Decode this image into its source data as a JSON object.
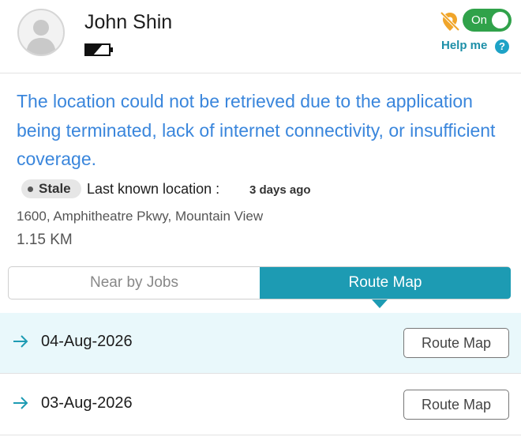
{
  "user": {
    "name": "John Shin"
  },
  "tracking": {
    "toggle_label": "On",
    "help_label": "Help me",
    "help_glyph": "?"
  },
  "message": "The location could not be retrieved due to the application being terminated, lack of internet connectivity, or insufficient coverage.",
  "location": {
    "status_badge": "Stale",
    "last_known_label": "Last known location :",
    "last_known_time": "3 days ago",
    "address": "1600, Amphitheatre Pkwy, Mountain View",
    "distance": "1.15 KM"
  },
  "tabs": [
    {
      "label": "Near by Jobs",
      "active": false
    },
    {
      "label": "Route Map",
      "active": true
    }
  ],
  "routes": [
    {
      "date": "04-Aug-2026",
      "button_label": "Route Map",
      "highlighted": true
    },
    {
      "date": "03-Aug-2026",
      "button_label": "Route Map",
      "highlighted": false
    }
  ],
  "colors": {
    "accent": "#1d9bb3",
    "message": "#3a86dc",
    "toggle_on": "#30a24a",
    "geo_icon": "#f0a52a"
  },
  "icons": {
    "avatar": "person-silhouette-icon",
    "battery": "battery-icon",
    "geo": "location-off-icon",
    "help": "help-icon",
    "row_arrow": "arrow-right-icon"
  }
}
